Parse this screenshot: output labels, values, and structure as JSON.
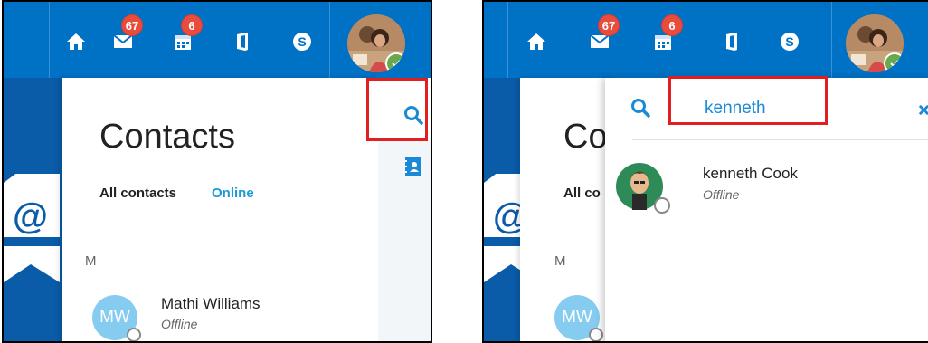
{
  "screens": [
    {
      "topbar": {
        "mail_badge": "67",
        "calendar_badge": "6",
        "icons": [
          "home-icon",
          "mail-icon",
          "calendar-icon",
          "office-icon",
          "skype-icon",
          "user-avatar"
        ]
      },
      "contacts": {
        "title": "Contacts",
        "tab_all": "All contacts",
        "tab_online": "Online",
        "section_letter": "M",
        "contact": {
          "initials": "MW",
          "name": "Mathi Williams",
          "status": "Offline"
        }
      }
    },
    {
      "topbar": {
        "mail_badge": "67",
        "calendar_badge": "6"
      },
      "contacts": {
        "title_partial": "Co",
        "tab_all_partial": "All co",
        "section_letter": "M",
        "contact_initials_partial": "MW"
      },
      "search": {
        "value": "kenneth",
        "result": {
          "name": "kenneth Cook",
          "status": "Offline"
        }
      }
    }
  ],
  "colors": {
    "topbar_blue": "#0072c6",
    "accent_blue": "#1a8ad6",
    "badge_red": "#e74c3c",
    "highlight_red": "#e02020",
    "avatar_light_blue": "#86cbf0"
  }
}
